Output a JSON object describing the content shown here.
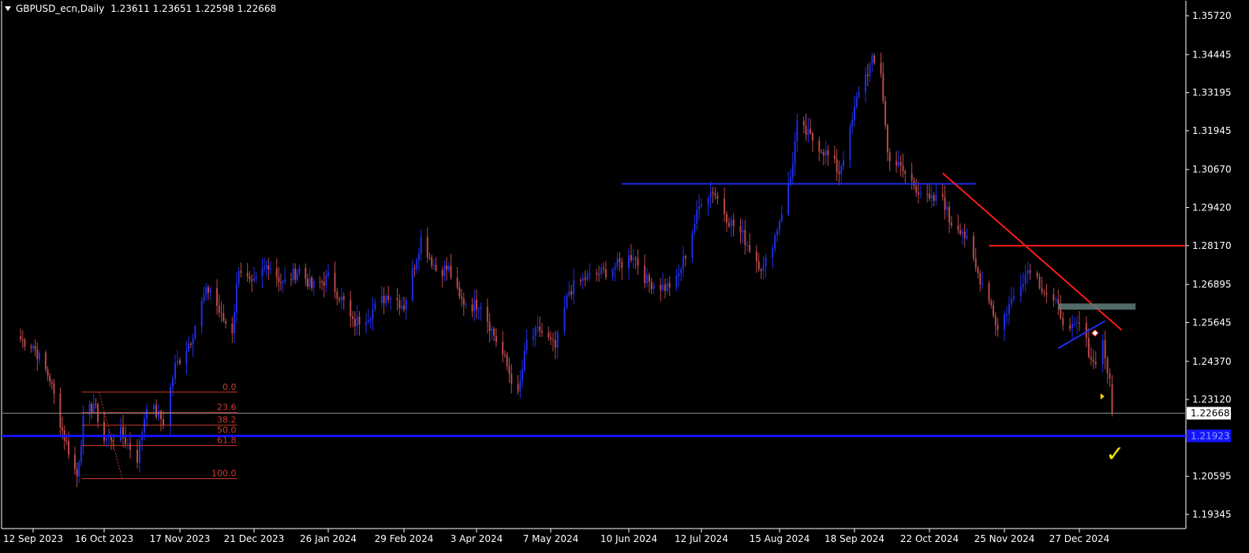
{
  "header": {
    "symbol": "GBPUSD_ecn,Daily",
    "ohlc": "1.23611 1.23651 1.22598 1.22668"
  },
  "colors": {
    "background": "#000000",
    "bull_candle": "#1f2ee8",
    "bear_candle": "#b94a4a",
    "axis_text": "#ffffff",
    "trend_line_blue": "#1f2ee8",
    "trend_line_red": "#ff1a1a",
    "fib_color": "#cc3b2e",
    "support_line": "#1414ff",
    "check_mark": "#ffe600",
    "zone": "#5f7f7a"
  },
  "chart_data": {
    "type": "candlestick",
    "y_ticks": [
      "1.35720",
      "1.34445",
      "1.33195",
      "1.31945",
      "1.30670",
      "1.29420",
      "1.28170",
      "1.26895",
      "1.25645",
      "1.24370",
      "1.23120",
      "1.20595",
      "1.19345"
    ],
    "ylim": [
      1.189,
      1.36
    ],
    "x_ticks": [
      "12 Sep 2023",
      "16 Oct 2023",
      "17 Nov 2023",
      "21 Dec 2023",
      "26 Jan 2024",
      "29 Feb 2024",
      "3 Apr 2024",
      "7 May 2024",
      "10 Jun 2024",
      "12 Jul 2024",
      "15 Aug 2024",
      "18 Sep 2024",
      "22 Oct 2024",
      "25 Nov 2024",
      "27 Dec 2024"
    ],
    "current_price": "1.22668",
    "support_price": "1.21923",
    "close_path": [
      [
        "2023-09-06",
        1.251
      ],
      [
        "2023-09-12",
        1.249
      ],
      [
        "2023-09-20",
        1.238
      ],
      [
        "2023-09-26",
        1.221
      ],
      [
        "2023-10-03",
        1.206
      ],
      [
        "2023-10-06",
        1.224
      ],
      [
        "2023-10-11",
        1.23
      ],
      [
        "2023-10-16",
        1.218
      ],
      [
        "2023-10-23",
        1.22
      ],
      [
        "2023-10-30",
        1.212
      ],
      [
        "2023-11-03",
        1.23
      ],
      [
        "2023-11-10",
        1.224
      ],
      [
        "2023-11-15",
        1.242
      ],
      [
        "2023-11-22",
        1.251
      ],
      [
        "2023-11-28",
        1.265
      ],
      [
        "2023-12-01",
        1.268
      ],
      [
        "2023-12-06",
        1.258
      ],
      [
        "2023-12-11",
        1.254
      ],
      [
        "2023-12-14",
        1.275
      ],
      [
        "2023-12-20",
        1.268
      ],
      [
        "2023-12-28",
        1.276
      ],
      [
        "2024-01-04",
        1.269
      ],
      [
        "2024-01-12",
        1.274
      ],
      [
        "2024-01-18",
        1.268
      ],
      [
        "2024-01-26",
        1.271
      ],
      [
        "2024-02-02",
        1.263
      ],
      [
        "2024-02-06",
        1.256
      ],
      [
        "2024-02-13",
        1.259
      ],
      [
        "2024-02-22",
        1.266
      ],
      [
        "2024-02-29",
        1.262
      ],
      [
        "2024-03-08",
        1.284
      ],
      [
        "2024-03-15",
        1.274
      ],
      [
        "2024-03-21",
        1.274
      ],
      [
        "2024-03-26",
        1.264
      ],
      [
        "2024-04-01",
        1.262
      ],
      [
        "2024-04-05",
        1.263
      ],
      [
        "2024-04-10",
        1.254
      ],
      [
        "2024-04-16",
        1.244
      ],
      [
        "2024-04-22",
        1.232
      ],
      [
        "2024-04-26",
        1.25
      ],
      [
        "2024-05-02",
        1.254
      ],
      [
        "2024-05-09",
        1.248
      ],
      [
        "2024-05-15",
        1.267
      ],
      [
        "2024-05-22",
        1.271
      ],
      [
        "2024-05-30",
        1.273
      ],
      [
        "2024-06-07",
        1.276
      ],
      [
        "2024-06-12",
        1.279
      ],
      [
        "2024-06-18",
        1.27
      ],
      [
        "2024-06-26",
        1.268
      ],
      [
        "2024-07-01",
        1.27
      ],
      [
        "2024-07-05",
        1.279
      ],
      [
        "2024-07-12",
        1.297
      ],
      [
        "2024-07-17",
        1.3
      ],
      [
        "2024-07-24",
        1.29
      ],
      [
        "2024-07-30",
        1.285
      ],
      [
        "2024-08-05",
        1.277
      ],
      [
        "2024-08-08",
        1.274
      ],
      [
        "2024-08-13",
        1.285
      ],
      [
        "2024-08-20",
        1.304
      ],
      [
        "2024-08-23",
        1.321
      ],
      [
        "2024-08-28",
        1.318
      ],
      [
        "2024-09-04",
        1.313
      ],
      [
        "2024-09-11",
        1.306
      ],
      [
        "2024-09-16",
        1.319
      ],
      [
        "2024-09-20",
        1.333
      ],
      [
        "2024-09-26",
        1.342
      ],
      [
        "2024-09-30",
        1.339
      ],
      [
        "2024-10-03",
        1.312
      ],
      [
        "2024-10-10",
        1.306
      ],
      [
        "2024-10-16",
        1.301
      ],
      [
        "2024-10-22",
        1.296
      ],
      [
        "2024-10-28",
        1.298
      ],
      [
        "2024-10-31",
        1.29
      ],
      [
        "2024-11-06",
        1.287
      ],
      [
        "2024-11-12",
        1.274
      ],
      [
        "2024-11-18",
        1.265
      ],
      [
        "2024-11-22",
        1.254
      ],
      [
        "2024-11-27",
        1.262
      ],
      [
        "2024-12-02",
        1.27
      ],
      [
        "2024-12-06",
        1.275
      ],
      [
        "2024-12-12",
        1.267
      ],
      [
        "2024-12-18",
        1.261
      ],
      [
        "2024-12-23",
        1.253
      ],
      [
        "2024-12-27",
        1.256
      ],
      [
        "2025-01-02",
        1.243
      ],
      [
        "2025-01-06",
        1.25
      ],
      [
        "2025-01-09",
        1.236
      ],
      [
        "2025-01-10",
        1.2267
      ]
    ],
    "lines": {
      "blue_resistance": {
        "from": [
          "2024-06-07",
          1.302
        ],
        "to": [
          "2024-11-12",
          1.302
        ]
      },
      "red_horizontal": {
        "from": [
          "2024-11-18",
          1.2817
        ],
        "to": [
          "2025-02-17",
          1.2817
        ]
      },
      "red_trendline": {
        "from": [
          "2024-10-28",
          1.3055
        ],
        "to": [
          "2025-01-14",
          1.254
        ]
      },
      "blue_flag_line": {
        "from": [
          "2024-12-18",
          1.248
        ],
        "to": [
          "2025-01-07",
          1.257
        ]
      },
      "support": {
        "price": 1.21923
      }
    },
    "zone": {
      "from": [
        "2024-12-18",
        1.2627
      ],
      "to": [
        "2025-01-20",
        1.2607
      ]
    },
    "fibonacci": {
      "from": [
        "2023-10-06",
        1.2336
      ],
      "to": [
        "2023-10-31",
        1.2052
      ],
      "levels": [
        {
          "ratio": 0.0,
          "label": "0.0"
        },
        {
          "ratio": 0.236,
          "label": "23.6"
        },
        {
          "ratio": 0.382,
          "label": "38.2"
        },
        {
          "ratio": 0.5,
          "label": "50.0"
        },
        {
          "ratio": 0.618,
          "label": "61.8"
        },
        {
          "ratio": 1.0,
          "label": "100.0"
        }
      ]
    },
    "annotations": [
      {
        "type": "check",
        "label": "✓",
        "at": [
          "2025-01-10",
          1.213
        ]
      }
    ]
  }
}
